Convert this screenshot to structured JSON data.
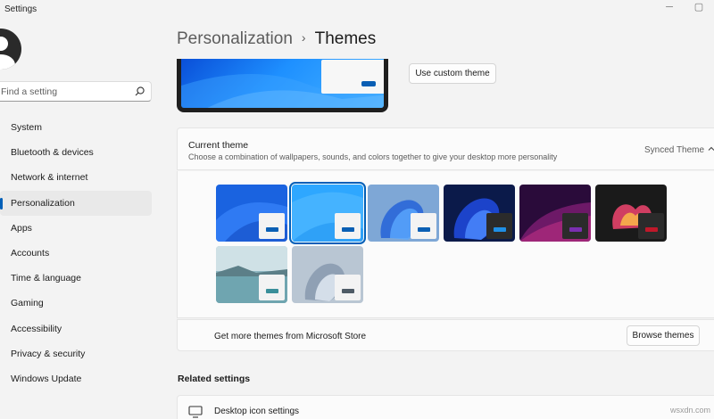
{
  "window": {
    "title": "Settings"
  },
  "search": {
    "placeholder": "Find a setting"
  },
  "sidebar": {
    "items": [
      {
        "label": "System"
      },
      {
        "label": "Bluetooth & devices"
      },
      {
        "label": "Network & internet"
      },
      {
        "label": "Personalization",
        "active": true
      },
      {
        "label": "Apps"
      },
      {
        "label": "Accounts"
      },
      {
        "label": "Time & language"
      },
      {
        "label": "Gaming"
      },
      {
        "label": "Accessibility"
      },
      {
        "label": "Privacy & security"
      },
      {
        "label": "Windows Update"
      }
    ]
  },
  "breadcrumb": {
    "parent": "Personalization",
    "separator": "›",
    "current": "Themes"
  },
  "custom_theme_button": "Use custom theme",
  "current_theme": {
    "title": "Current theme",
    "description": "Choose a combination of wallpapers, sounds, and colors together to give your desktop more personality",
    "value": "Synced Theme"
  },
  "themes": [
    {
      "name": "windows-light-blue",
      "bg": "#1a63e0",
      "window": "#f3f3f3",
      "accent": "#0a5fb4",
      "selected": false
    },
    {
      "name": "windows-glow",
      "bg": "#2ea7ff",
      "window": "#f3f3f3",
      "accent": "#0a5fb4",
      "selected": true
    },
    {
      "name": "bloom-light",
      "bg": "#7ea7d6",
      "window": "#f3f3f3",
      "accent": "#0a5fb4",
      "selected": false
    },
    {
      "name": "bloom-dark",
      "bg": "#0b1a4a",
      "window": "#2b2b2b",
      "accent": "#1f8fe5",
      "selected": false
    },
    {
      "name": "glow-dark",
      "bg": "#2a0b3a",
      "window": "#2b2b2b",
      "accent": "#7a2fb0",
      "selected": false
    },
    {
      "name": "flow-dark",
      "bg": "#1a1a1a",
      "window": "#2b2b2b",
      "accent": "#c0182a",
      "selected": false
    },
    {
      "name": "captured-motion",
      "bg": "#8fb7c2",
      "window": "#f3f3f3",
      "accent": "#3a8f9a",
      "selected": false
    },
    {
      "name": "flow-light",
      "bg": "#b9c6d3",
      "window": "#f3f3f3",
      "accent": "#4e5b66",
      "selected": false
    }
  ],
  "store": {
    "text": "Get more themes from Microsoft Store",
    "button": "Browse themes"
  },
  "related": {
    "title": "Related settings",
    "desktop_icon": "Desktop icon settings"
  },
  "watermark": "wsxdn.com",
  "colors": {
    "accent": "#005fb8",
    "background": "#f3f3f3"
  }
}
